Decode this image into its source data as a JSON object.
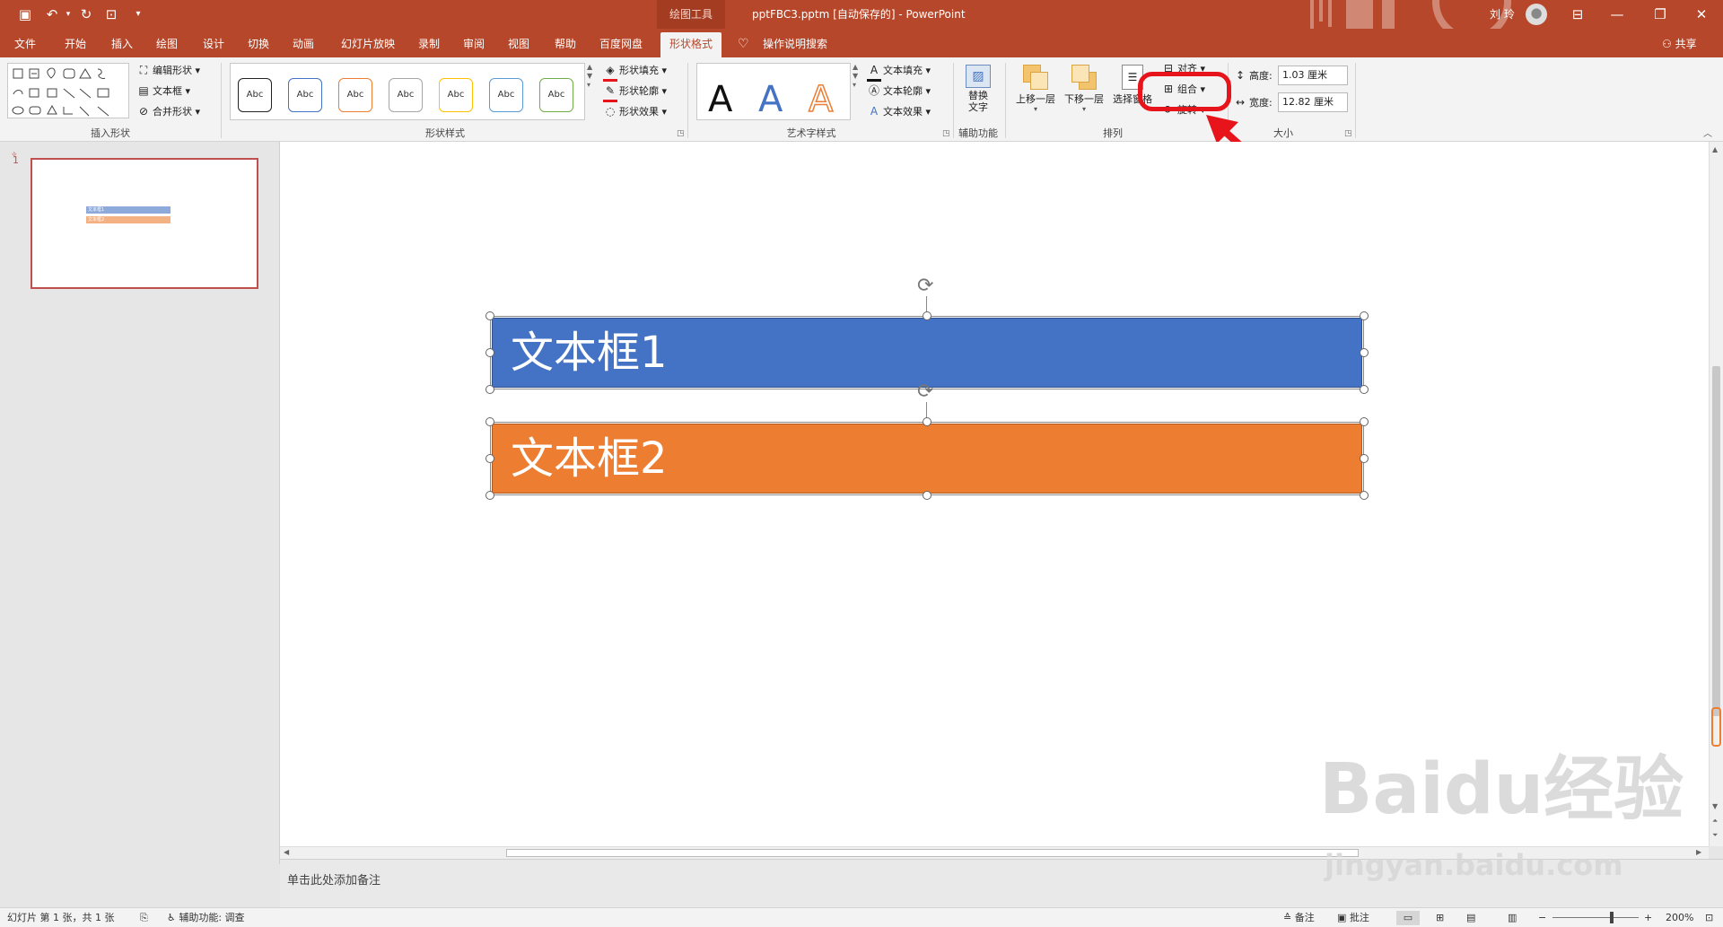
{
  "titlebar": {
    "context_tab": "绘图工具",
    "doc_title": "pptFBC3.pptm [自动保存的]  -  PowerPoint",
    "user": "刘 玲"
  },
  "tabs": [
    "文件",
    "开始",
    "插入",
    "绘图",
    "设计",
    "切换",
    "动画",
    "幻灯片放映",
    "录制",
    "审阅",
    "视图",
    "帮助",
    "百度网盘",
    "形状格式"
  ],
  "active_tab": "形状格式",
  "tell_me": "操作说明搜索",
  "share": "共享",
  "ribbon": {
    "insert_shapes": {
      "label": "插入形状",
      "edit_shape": "编辑形状",
      "text_box": "文本框",
      "merge_shapes": "合并形状"
    },
    "shape_styles": {
      "label": "形状样式",
      "sample": "Abc",
      "fill": "形状填充",
      "outline": "形状轮廓",
      "effects": "形状效果"
    },
    "wordart": {
      "label": "艺术字样式",
      "glyph": "A",
      "text_fill": "文本填充",
      "text_outline": "文本轮廓",
      "text_effects": "文本效果"
    },
    "accessibility": {
      "label": "辅助功能",
      "alt_text_line1": "替换",
      "alt_text_line2": "文字"
    },
    "arrange": {
      "label": "排列",
      "bring_forward": "上移一层",
      "send_backward": "下移一层",
      "selection_pane": "选择窗格",
      "align": "对齐",
      "group": "组合",
      "rotate": "旋转"
    },
    "size": {
      "label": "大小",
      "height_label": "高度:",
      "height_value": "1.03 厘米",
      "width_label": "宽度:",
      "width_value": "12.82 厘米"
    }
  },
  "thumbnail": {
    "number": "1",
    "box1": "文本框1",
    "box2": "文本框2"
  },
  "slide": {
    "box1": {
      "text": "文本框1",
      "color": "#4472c4"
    },
    "box2": {
      "text": "文本框2",
      "color": "#ed7d31"
    }
  },
  "notes_placeholder": "单击此处添加备注",
  "statusbar": {
    "slide_info": "幻灯片 第 1 张，共 1 张",
    "accessibility": "辅助功能: 调查",
    "notes": "备注",
    "comments": "批注",
    "zoom": "200%"
  },
  "watermark": {
    "brand": "Baidu经验",
    "url": "jingyan.baidu.com"
  },
  "colors": {
    "accent": "#b7472a",
    "highlight": "#e8141b"
  }
}
